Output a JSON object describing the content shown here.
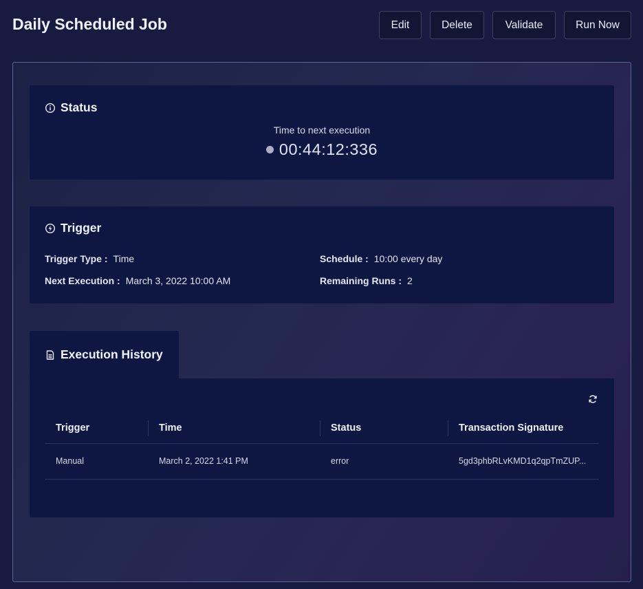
{
  "header": {
    "title": "Daily Scheduled Job",
    "buttons": {
      "edit": "Edit",
      "delete": "Delete",
      "validate": "Validate",
      "run_now": "Run Now"
    }
  },
  "status": {
    "title": "Status",
    "icon": "info-icon",
    "next_label": "Time to next execution",
    "countdown": "00:44:12:336"
  },
  "trigger": {
    "title": "Trigger",
    "icon": "lightning-icon",
    "trigger_type_label": "Trigger Type :",
    "trigger_type": "Time",
    "schedule_label": "Schedule :",
    "schedule": "10:00 every day",
    "next_execution_label": "Next Execution :",
    "next_execution": "March 3, 2022 10:00 AM",
    "remaining_runs_label": "Remaining Runs :",
    "remaining_runs": "2"
  },
  "history": {
    "title": "Execution History",
    "icon": "document-icon",
    "refresh_icon": "refresh-icon",
    "columns": [
      "Trigger",
      "Time",
      "Status",
      "Transaction Signature"
    ],
    "rows": [
      {
        "trigger": "Manual",
        "time": "March 2, 2022 1:41 PM",
        "status": "error",
        "signature": "5gd3phbRLvKMD1q2qpTmZUP..."
      }
    ]
  }
}
